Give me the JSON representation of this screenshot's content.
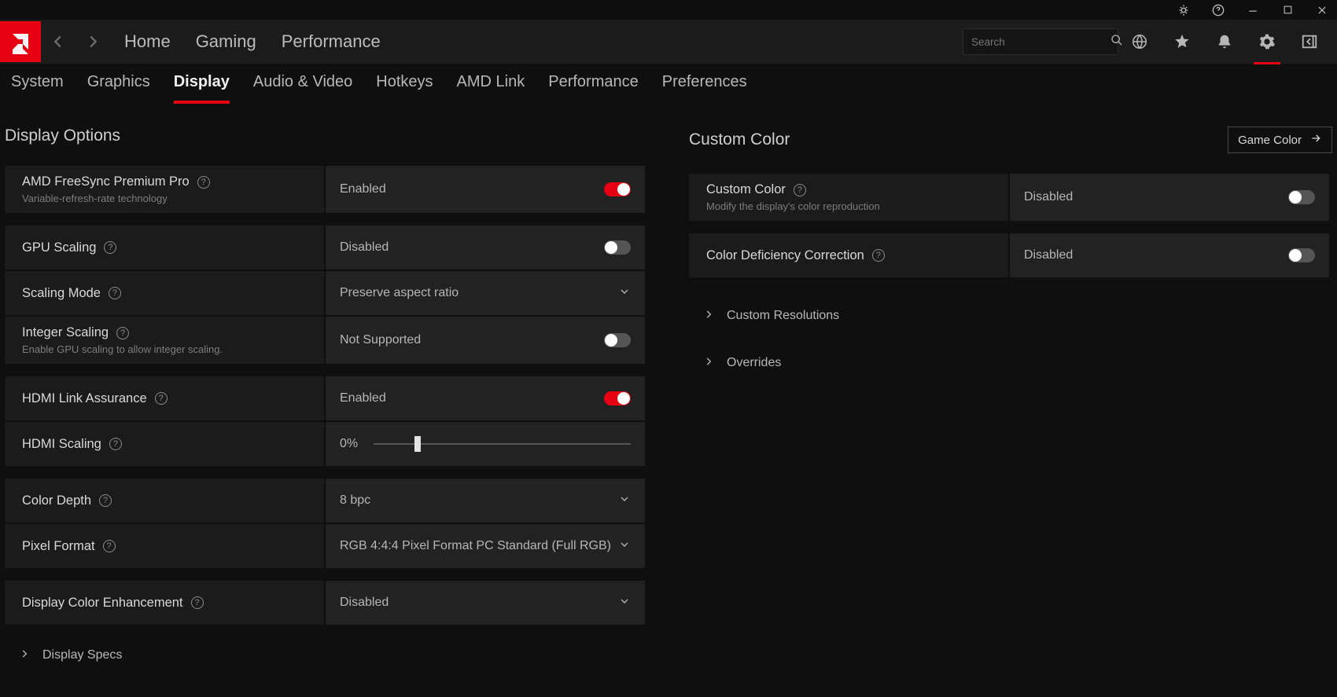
{
  "titlebar": {
    "tooltip": ""
  },
  "search": {
    "placeholder": "Search"
  },
  "mainnav": {
    "home": "Home",
    "gaming": "Gaming",
    "performance": "Performance"
  },
  "tabs": {
    "system": "System",
    "graphics": "Graphics",
    "display": "Display",
    "audio_video": "Audio & Video",
    "hotkeys": "Hotkeys",
    "amd_link": "AMD Link",
    "performance": "Performance",
    "preferences": "Preferences"
  },
  "left": {
    "title": "Display Options",
    "freesync": {
      "label": "AMD FreeSync Premium Pro",
      "sub": "Variable-refresh-rate technology",
      "value": "Enabled",
      "on": true
    },
    "gpu_scaling": {
      "label": "GPU Scaling",
      "value": "Disabled",
      "on": false
    },
    "scaling_mode": {
      "label": "Scaling Mode",
      "value": "Preserve aspect ratio"
    },
    "integer_scaling": {
      "label": "Integer Scaling",
      "sub": "Enable GPU scaling to allow integer scaling.",
      "value": "Not Supported",
      "on": false
    },
    "hdmi_link": {
      "label": "HDMI Link Assurance",
      "value": "Enabled",
      "on": true
    },
    "hdmi_scaling": {
      "label": "HDMI Scaling",
      "value": "0%"
    },
    "color_depth": {
      "label": "Color Depth",
      "value": "8 bpc"
    },
    "pixel_format": {
      "label": "Pixel Format",
      "value": "RGB 4:4:4 Pixel Format PC Standard (Full RGB)"
    },
    "color_enhance": {
      "label": "Display Color Enhancement",
      "value": "Disabled"
    },
    "display_specs": "Display Specs"
  },
  "right": {
    "title": "Custom Color",
    "game_color_btn": "Game Color",
    "custom_color": {
      "label": "Custom Color",
      "sub": "Modify the display's color reproduction",
      "value": "Disabled",
      "on": false
    },
    "deficiency": {
      "label": "Color Deficiency Correction",
      "value": "Disabled",
      "on": false
    },
    "custom_res": "Custom Resolutions",
    "overrides": "Overrides"
  }
}
